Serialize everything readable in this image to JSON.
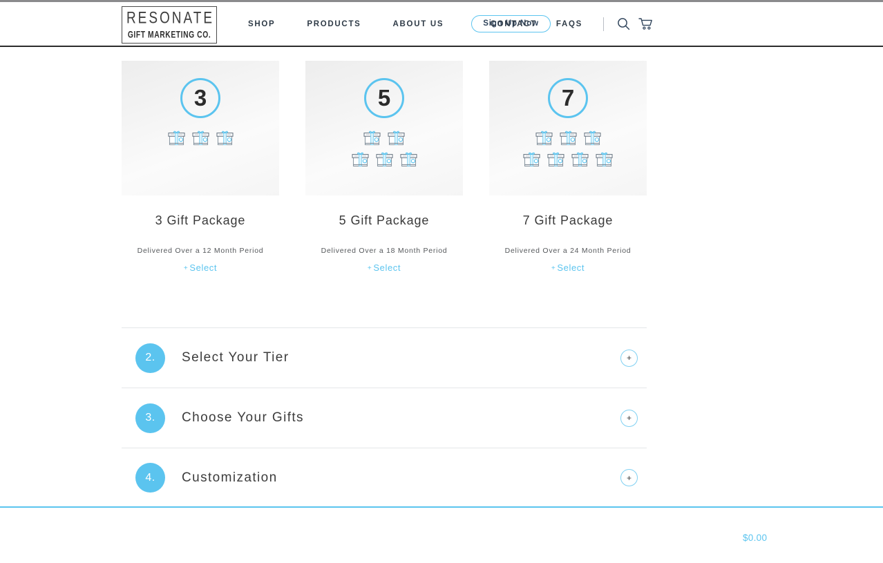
{
  "header": {
    "logo_line1": "RESONATE",
    "logo_line2": "GIFT MARKETING CO.",
    "nav_left": [
      {
        "label": "SHOP",
        "name": "nav-shop"
      },
      {
        "label": "PRODUCTS",
        "name": "nav-products"
      },
      {
        "label": "ABOUT US",
        "name": "nav-about-us"
      }
    ],
    "signup_label": "Sign Up Now",
    "nav_right": [
      {
        "label": "CONTACT",
        "name": "nav-contact"
      },
      {
        "label": "FAQS",
        "name": "nav-faqs"
      }
    ],
    "search_icon": "search-icon",
    "cart_icon": "cart-icon"
  },
  "packages": [
    {
      "number": "3",
      "gift_count": 3,
      "gift_rows": [
        3
      ],
      "title": "3 Gift Package",
      "subtitle": "Delivered Over a 12 Month Period",
      "select_label": "Select",
      "select_plus": "+"
    },
    {
      "number": "5",
      "gift_count": 5,
      "gift_rows": [
        2,
        3
      ],
      "title": "5 Gift Package",
      "subtitle": "Delivered Over a 18 Month Period",
      "select_label": "Select",
      "select_plus": "+"
    },
    {
      "number": "7",
      "gift_count": 7,
      "gift_rows": [
        3,
        4
      ],
      "title": "7 Gift Package",
      "subtitle": "Delivered Over a 24 Month Period",
      "select_label": "Select",
      "select_plus": "+"
    }
  ],
  "accordion": [
    {
      "number": "2.",
      "label": "Select Your Tier",
      "toggle": "+"
    },
    {
      "number": "3.",
      "label": "Choose Your Gifts",
      "toggle": "+"
    },
    {
      "number": "4.",
      "label": "Customization",
      "toggle": "+"
    }
  ],
  "bottom_bar": {
    "total": "$0.00"
  },
  "colors": {
    "accent_blue": "#5bc4ef",
    "text_dark": "#3a3a3a",
    "nav_text": "#2f3b47"
  }
}
